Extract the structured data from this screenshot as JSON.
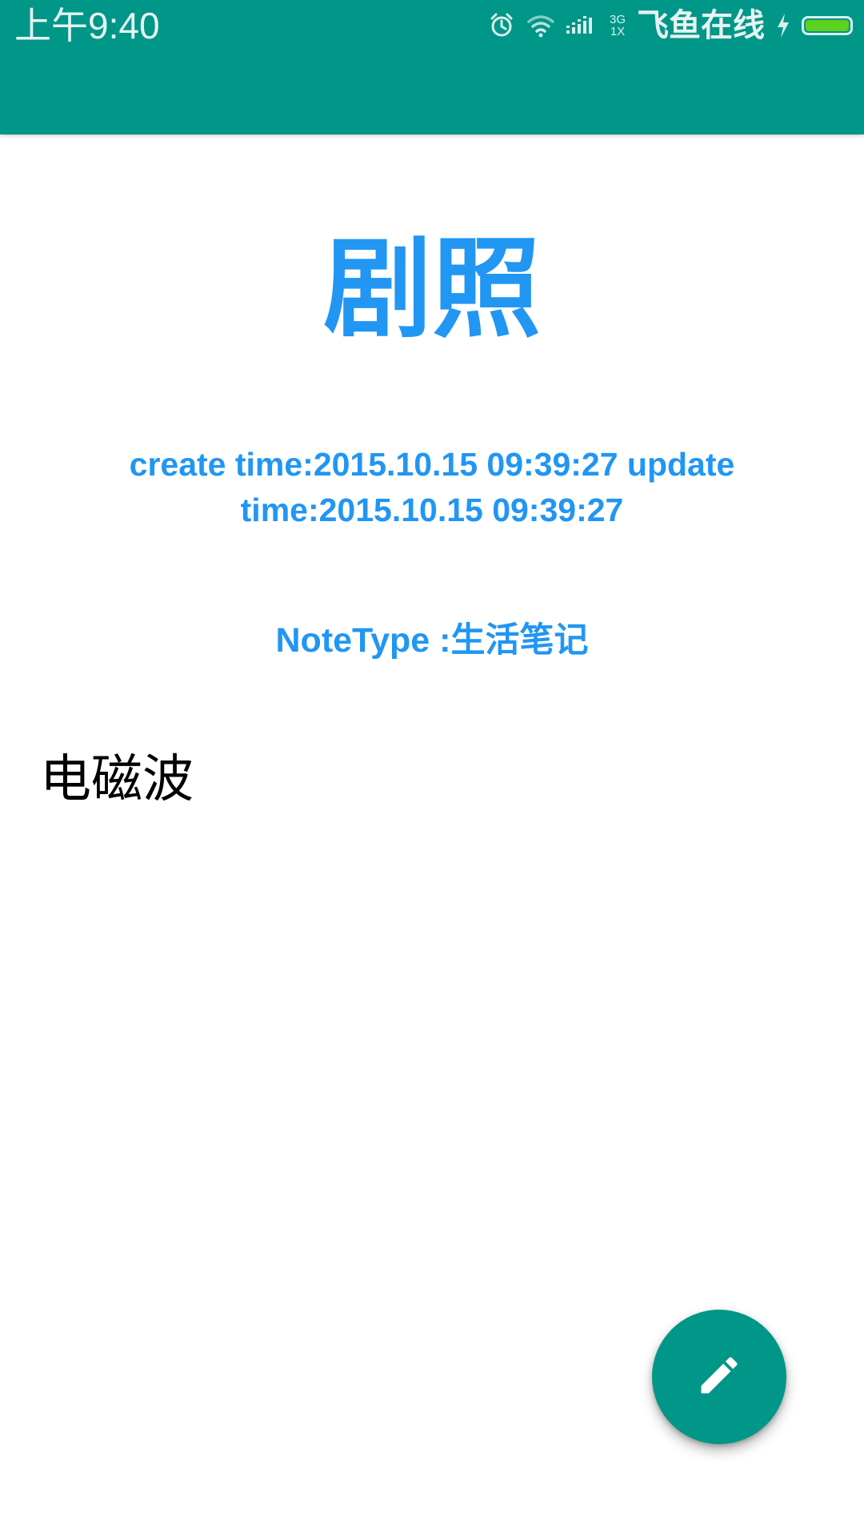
{
  "status_bar": {
    "time": "上午9:40",
    "network_top": "3G",
    "network_bottom": "1X",
    "carrier": "飞鱼在线",
    "icons": [
      "alarm-icon",
      "wifi-icon",
      "signal-icon",
      "charging-icon",
      "battery-icon"
    ]
  },
  "app_bar": {
    "color": "#009688"
  },
  "note": {
    "title": "剧照",
    "times": "create time:2015.10.15 09:39:27 update time:2015.10.15 09:39:27",
    "note_type": "NoteType :生活笔记",
    "content": "电磁波",
    "accent_color": "#2196f3"
  },
  "fab": {
    "icon": "edit-pencil-icon",
    "color": "#009688"
  }
}
